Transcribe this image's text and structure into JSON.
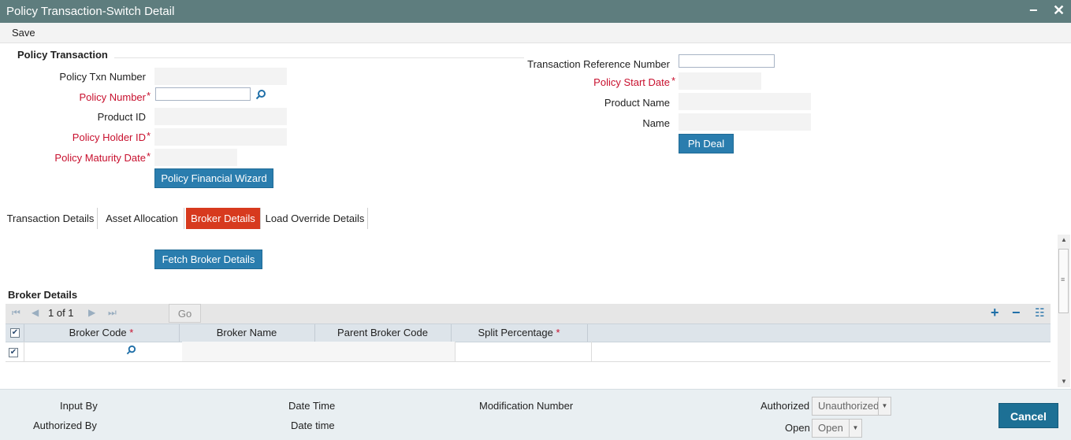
{
  "window": {
    "title": "Policy Transaction-Switch Detail",
    "minimize_glyph": "−",
    "close_glyph": "✕"
  },
  "toolbar": {
    "save_label": "Save"
  },
  "policy_transaction": {
    "section_title": "Policy Transaction",
    "txn_number_label": "Policy Txn Number",
    "policy_number_label": "Policy Number",
    "product_id_label": "Product ID",
    "holder_id_label": "Policy Holder ID",
    "maturity_date_label": "Policy Maturity Date",
    "wizard_button": "Policy Financial Wizard",
    "txn_ref_label": "Transaction Reference Number",
    "start_date_label": "Policy Start Date",
    "product_name_label": "Product Name",
    "name_label": "Name",
    "ph_deal_button": "Ph Deal",
    "required_mark": "*"
  },
  "tabs": [
    "Transaction Details",
    "Asset Allocation",
    "Broker Details",
    "Load Override Details"
  ],
  "active_tab": "Broker Details",
  "fetch_button": "Fetch Broker Details",
  "broker_grid": {
    "title": "Broker Details",
    "page_indicator": "1 of 1",
    "go_label": "Go",
    "columns": [
      {
        "label": "Broker Code",
        "required": true
      },
      {
        "label": "Broker Name",
        "required": false
      },
      {
        "label": "Parent Broker Code",
        "required": false
      },
      {
        "label": "Split Percentage",
        "required": true
      }
    ],
    "rows": [
      {
        "broker_code": "",
        "broker_name": "",
        "parent_broker_code": "",
        "split_percentage": "",
        "checked": true
      }
    ]
  },
  "footer": {
    "input_by": "Input By",
    "authorized_by": "Authorized By",
    "date_time_1": "Date Time",
    "date_time_2": "Date time",
    "modification_number": "Modification Number",
    "authorized_label": "Authorized",
    "authorized_value": "Unauthorized",
    "open_label": "Open",
    "open_value": "Open",
    "cancel_button": "Cancel"
  },
  "icons": {
    "search": "search-icon",
    "add": "plus-icon",
    "remove": "minus-icon",
    "list": "list-icon"
  },
  "colors": {
    "title_bar": "#5e7d7e",
    "button": "#2a7dae",
    "active_tab": "#d73a1e",
    "required": "#c8102e",
    "cancel_button": "#1d7095"
  }
}
